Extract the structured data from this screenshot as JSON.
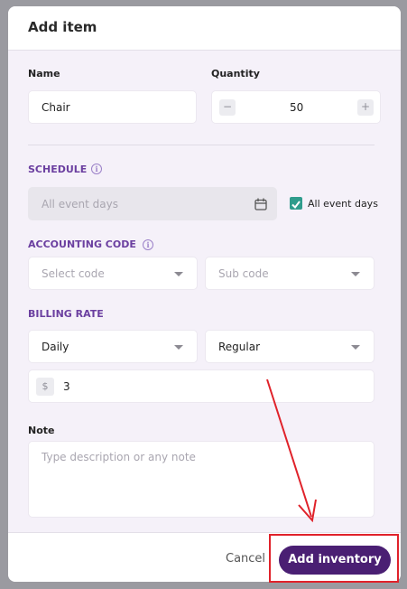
{
  "dialog": {
    "title": "Add item",
    "name_label": "Name",
    "name_value": "Chair",
    "quantity_label": "Quantity",
    "quantity_value": "50",
    "decrement": "−",
    "increment": "+",
    "schedule_label": "SCHEDULE",
    "schedule_placeholder": "All event days",
    "all_event_days_label": "All event days",
    "all_event_days_checked": true,
    "accounting_label": "ACCOUNTING CODE",
    "select_code_placeholder": "Select code",
    "sub_code_placeholder": "Sub code",
    "billing_label": "BILLING RATE",
    "billing_period": "Daily",
    "billing_type": "Regular",
    "currency_symbol": "$",
    "rate_value": "3",
    "note_label": "Note",
    "note_placeholder": "Type description or any note",
    "cancel_label": "Cancel",
    "submit_label": "Add inventory"
  },
  "colors": {
    "accent": "#4a1f73",
    "section_label": "#6b3fa0",
    "checkbox": "#2f9c8c",
    "annotation": "#e0222a"
  }
}
